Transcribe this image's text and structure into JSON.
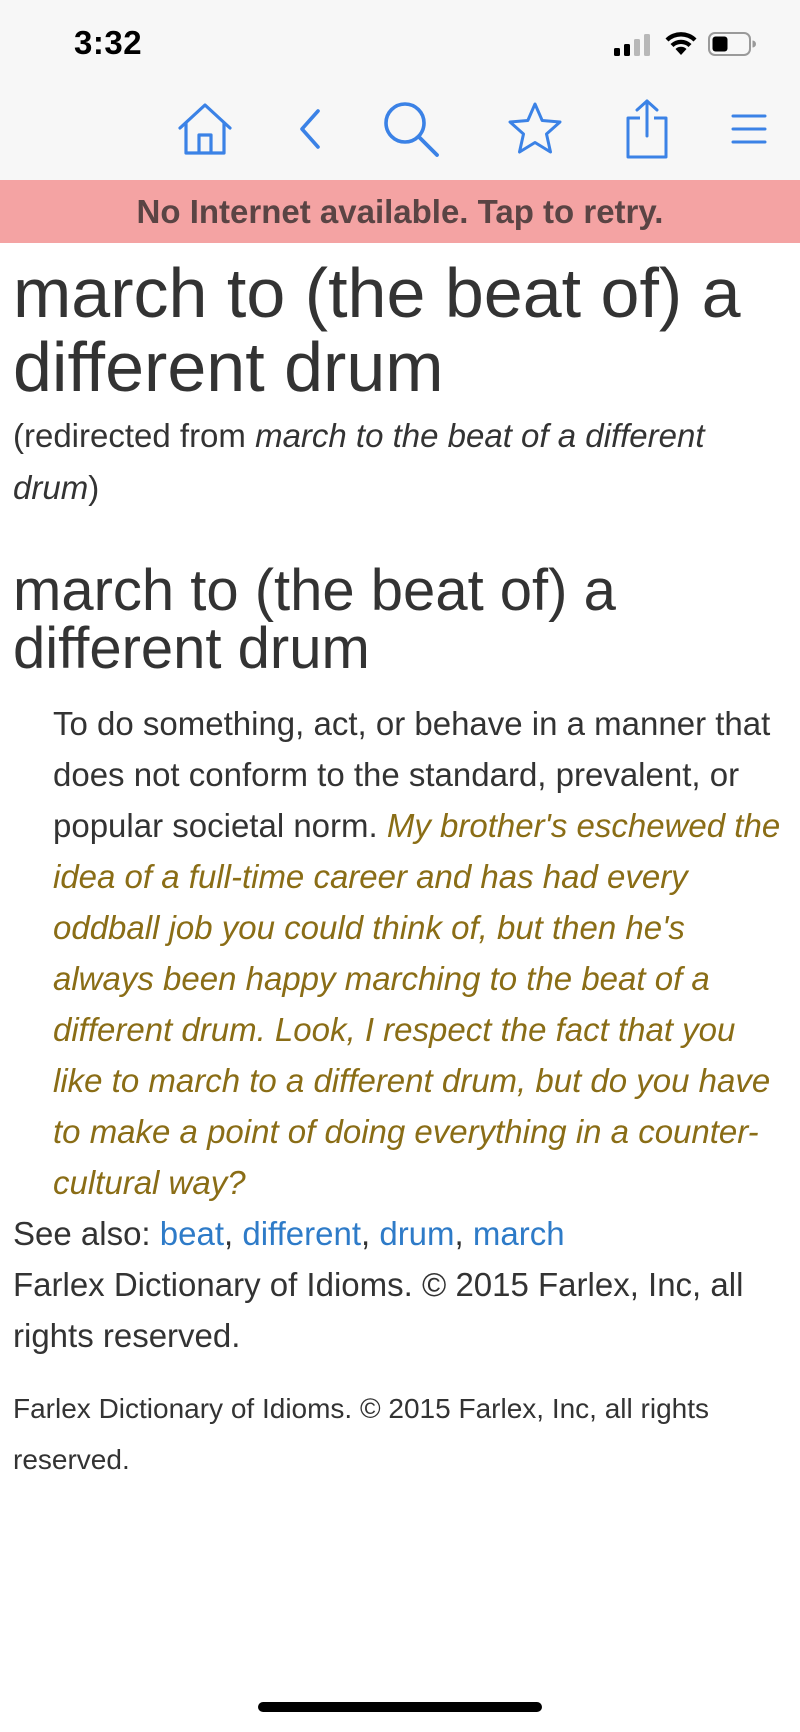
{
  "status_bar": {
    "time": "3:32"
  },
  "toolbar": {
    "buttons": [
      {
        "icon": "home-icon"
      },
      {
        "icon": "back-icon"
      },
      {
        "icon": "search-icon"
      },
      {
        "icon": "star-icon"
      },
      {
        "icon": "share-icon"
      },
      {
        "icon": "menu-icon"
      }
    ],
    "accent_color": "#3b82e6"
  },
  "banner": {
    "text": "No Internet available. Tap to retry.",
    "color": "#f4a3a3"
  },
  "entry": {
    "title": "march to (the beat of) a different drum",
    "redirect_prefix": "(redirected from ",
    "redirect_term": "march to the beat of a different drum",
    "redirect_suffix": ")",
    "subtitle": "march to (the beat of) a different drum",
    "definition": "To do something, act, or behave in a manner that does not conform to the standard, prevalent, or popular societal norm.",
    "example": "My brother's eschewed the idea of a full-time career and has had every oddball job you could think of, but then he's always been happy marching to the beat of a different drum. Look, I respect the fact that you like to march to a different drum, but do you have to make a point of doing everything in a counter-cultural way?",
    "example_color": "#8a6d16",
    "see_also_label": "See also:",
    "see_also_links": [
      "beat",
      "different",
      "drum",
      "march"
    ],
    "link_color": "#2e7bc8",
    "source_main": "Farlex Dictionary of Idioms. © 2015 Farlex, Inc, all rights reserved.",
    "source_footer": "Farlex Dictionary of Idioms. © 2015 Farlex, Inc, all rights reserved."
  }
}
